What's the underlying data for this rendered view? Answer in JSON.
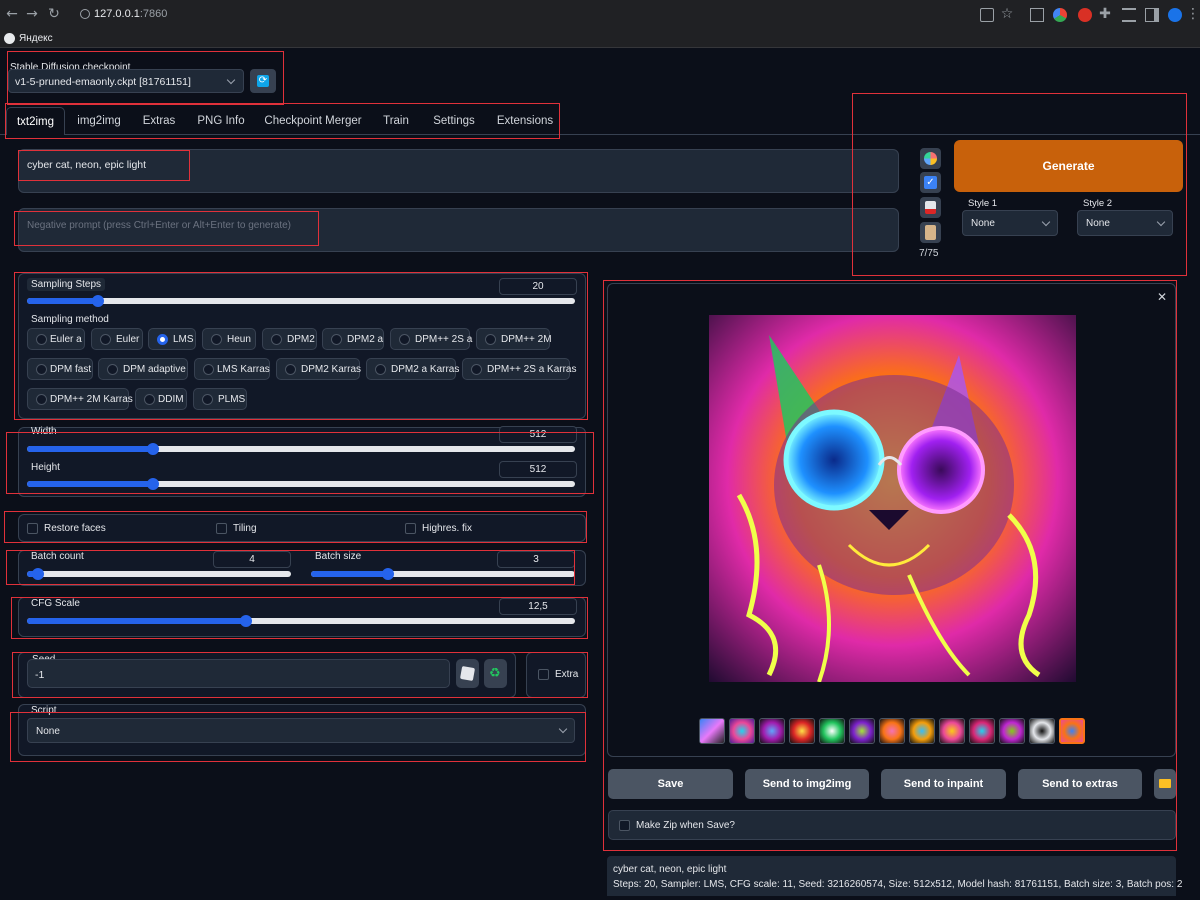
{
  "browser": {
    "url_host": "127.0.0.1",
    "url_port": ":7860",
    "bookmark": "Яндекс"
  },
  "checkpoint": {
    "label": "Stable Diffusion checkpoint",
    "value": "v1-5-pruned-emaonly.ckpt [81761151]"
  },
  "tabs": [
    "txt2img",
    "img2img",
    "Extras",
    "PNG Info",
    "Checkpoint Merger",
    "Train",
    "Settings",
    "Extensions"
  ],
  "prompt": {
    "value": "cyber cat, neon, epic light",
    "negative_placeholder": "Negative prompt (press Ctrl+Enter or Alt+Enter to generate)",
    "token_counter": "7/75"
  },
  "generate": {
    "label": "Generate",
    "style1_label": "Style 1",
    "style1_value": "None",
    "style2_label": "Style 2",
    "style2_value": "None"
  },
  "sampling": {
    "steps_label": "Sampling Steps",
    "steps_value": "20",
    "steps_fraction": 0.13,
    "method_label": "Sampling method",
    "methods": [
      "Euler a",
      "Euler",
      "LMS",
      "Heun",
      "DPM2",
      "DPM2 a",
      "DPM++ 2S a",
      "DPM++ 2M",
      "DPM fast",
      "DPM adaptive",
      "LMS Karras",
      "DPM2 Karras",
      "DPM2 a Karras",
      "DPM++ 2S a Karras",
      "DPM++ 2M Karras",
      "DDIM",
      "PLMS"
    ],
    "selected": "LMS"
  },
  "size": {
    "width_label": "Width",
    "width_value": "512",
    "width_fraction": 0.23,
    "height_label": "Height",
    "height_value": "512",
    "height_fraction": 0.23
  },
  "options": {
    "restore_faces": "Restore faces",
    "tiling": "Tiling",
    "highres": "Highres. fix"
  },
  "batch": {
    "count_label": "Batch count",
    "count_value": "4",
    "count_fraction": 0.04,
    "size_label": "Batch size",
    "size_value": "3",
    "size_fraction": 0.29
  },
  "cfg": {
    "label": "CFG Scale",
    "value": "12,5",
    "fraction": 0.4
  },
  "seed": {
    "label": "Seed",
    "value": "-1",
    "extra": "Extra"
  },
  "script": {
    "label": "Script",
    "value": "None"
  },
  "output": {
    "buttons": [
      "Save",
      "Send to img2img",
      "Send to inpaint",
      "Send to extras"
    ],
    "zip_label": "Make Zip when Save?",
    "info_line1": "cyber cat, neon, epic light",
    "info_line2": "Steps: 20, Sampler: LMS, CFG scale: 11, Seed: 3216260574, Size: 512x512, Model hash: 81761151, Batch size: 3, Batch pos: 2"
  },
  "colors": {
    "generate": "#c8610b",
    "accent": "#2563eb",
    "annotation": "#e0313a"
  }
}
